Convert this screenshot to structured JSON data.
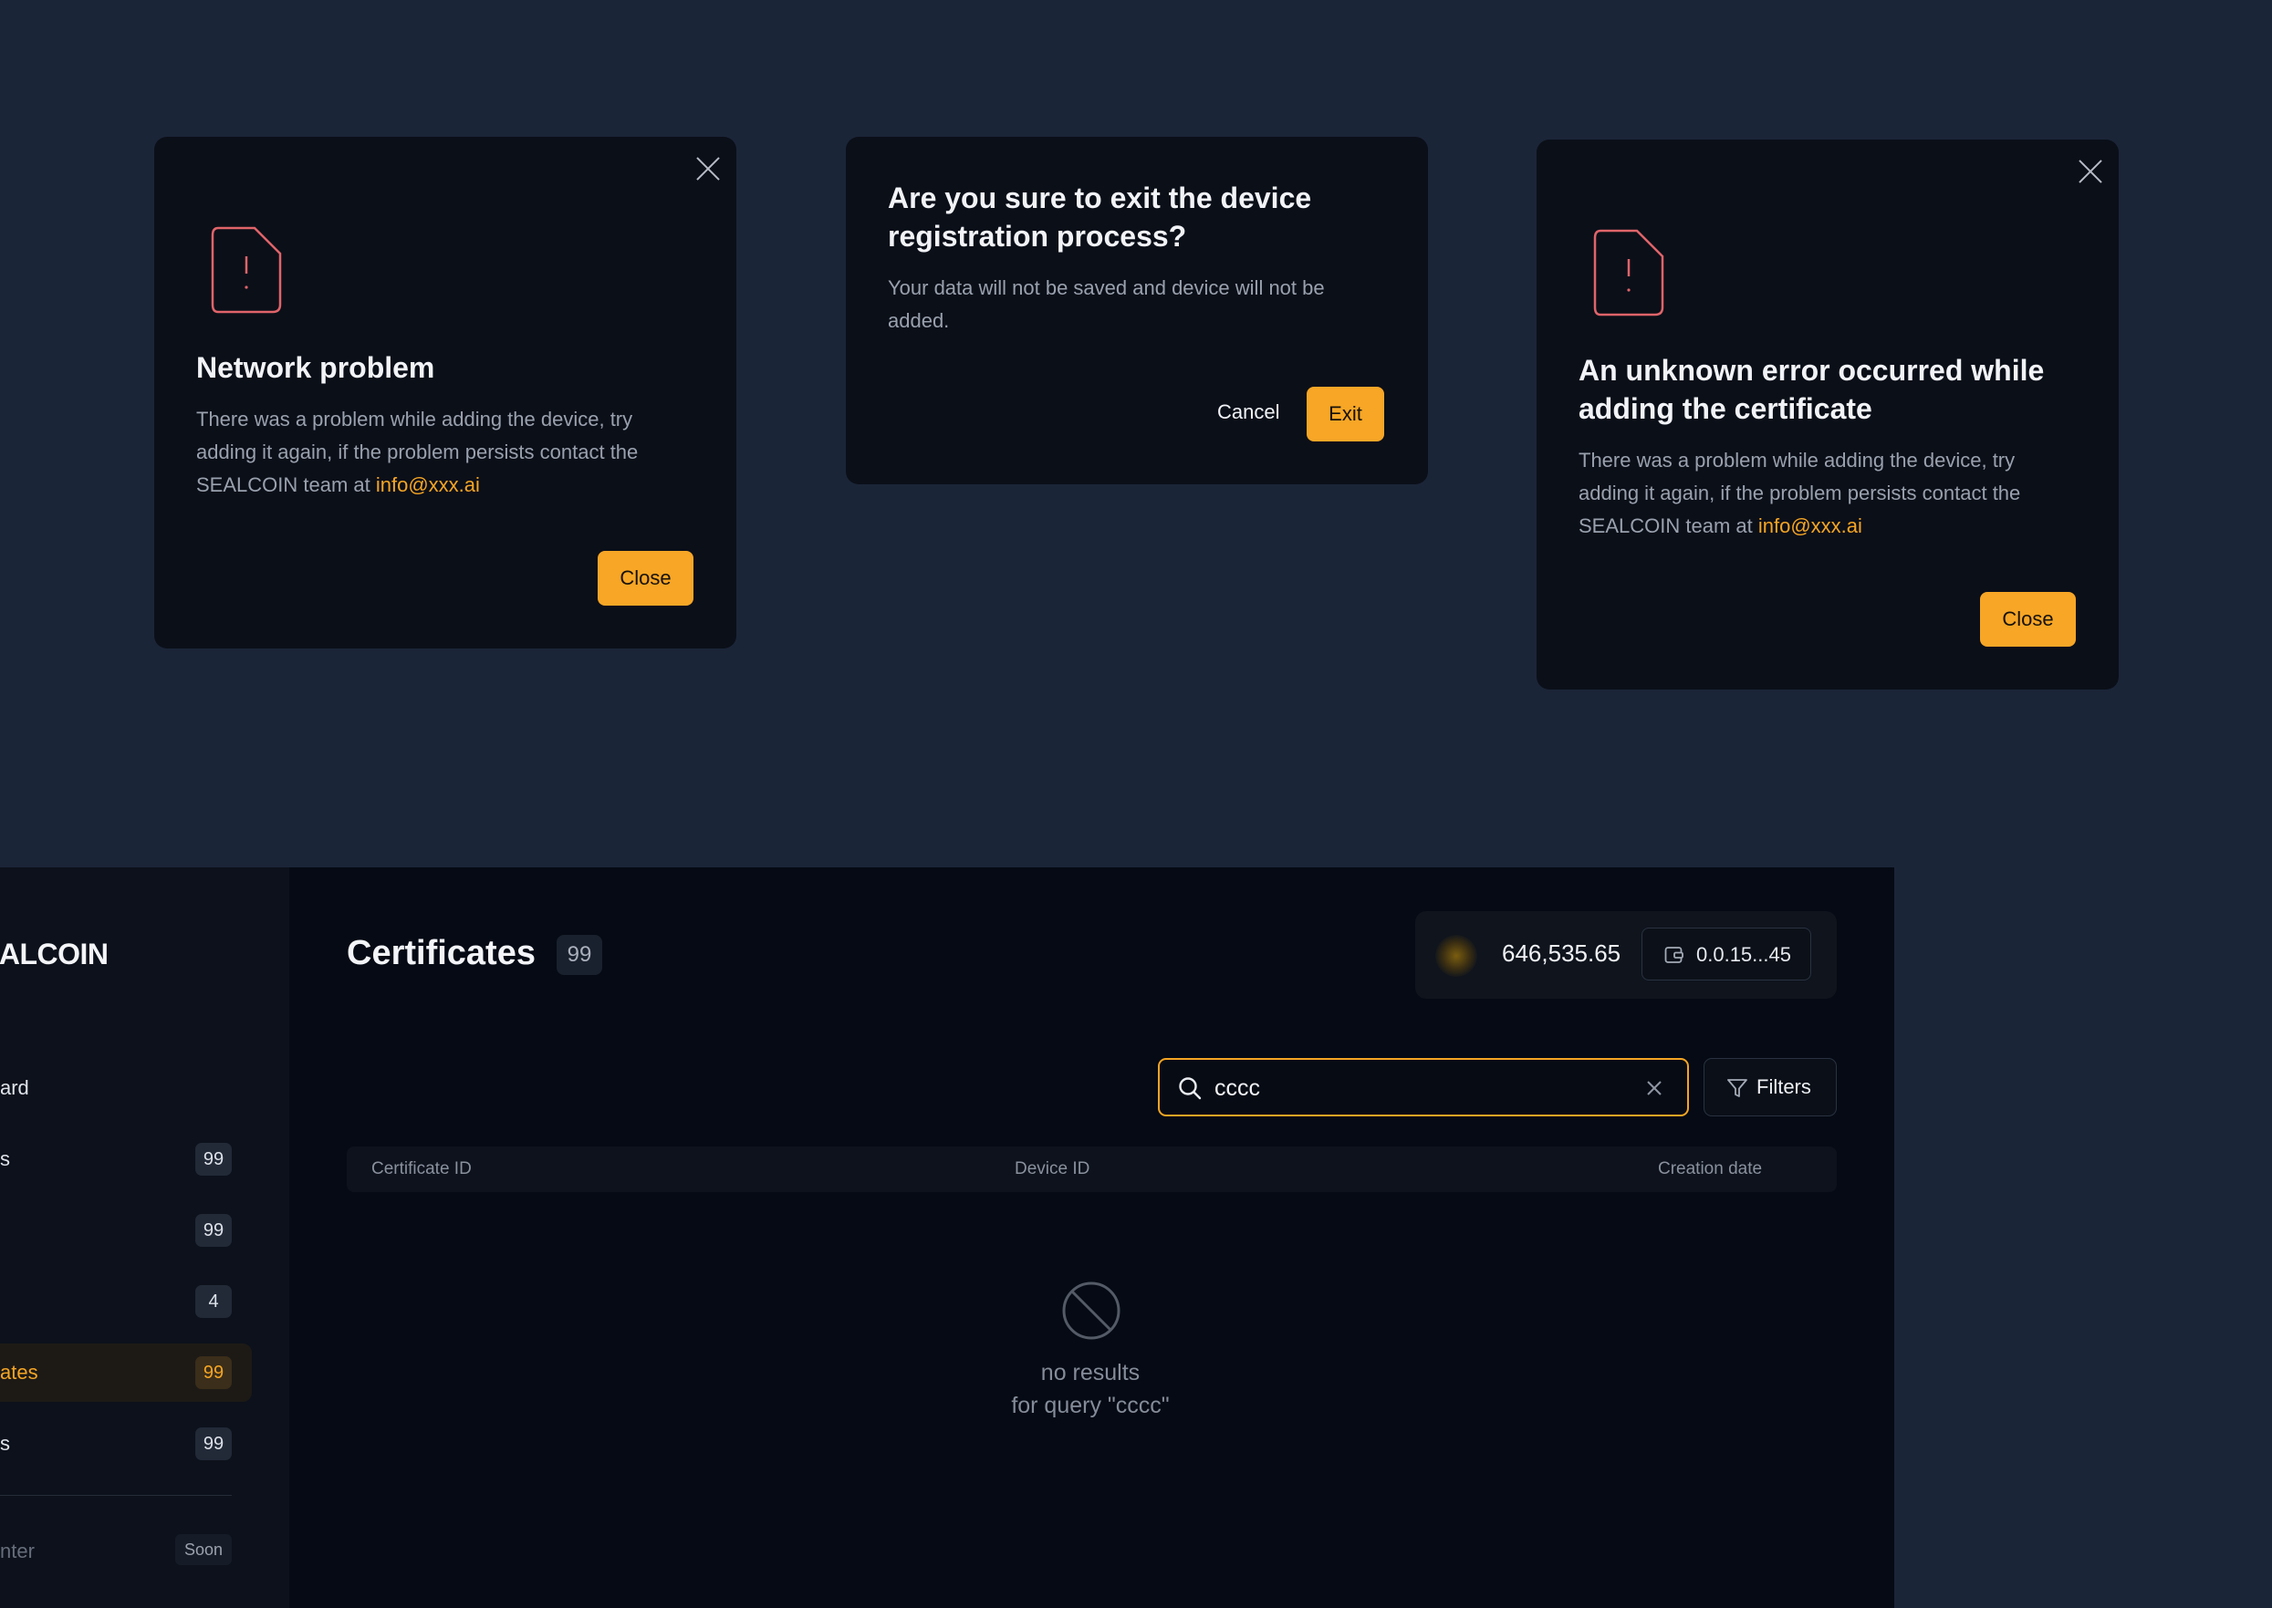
{
  "modal_network": {
    "title": "Network problem",
    "body": "There was a problem while adding the device, try adding it again, if the problem persists contact the SEALCOIN team at ",
    "email": "info@xxx.ai",
    "close_label": "Close"
  },
  "modal_exit": {
    "title": "Are you sure to exit the device registration process?",
    "body": "Your data will not be saved and device will not be added.",
    "cancel_label": "Cancel",
    "exit_label": "Exit"
  },
  "modal_unknown": {
    "title": "An unknown error occurred while adding the certificate",
    "body": "There was a problem while adding the device, try adding it again, if the problem persists contact the SEALCOIN team at ",
    "email": "info@xxx.ai",
    "close_label": "Close"
  },
  "sidebar": {
    "logo": "EALCOIN",
    "items": [
      {
        "label": "ard",
        "badge": ""
      },
      {
        "label": "s",
        "badge": "99"
      },
      {
        "label": "",
        "badge": "99"
      },
      {
        "label": "",
        "badge": "4"
      },
      {
        "label": "ates",
        "badge": "99"
      },
      {
        "label": "s",
        "badge": "99"
      }
    ],
    "soon_item": {
      "label": "nter",
      "badge": "Soon"
    }
  },
  "header": {
    "title": "Certificates",
    "count": "99",
    "balance": "646,535.65",
    "address": "0.0.15...45"
  },
  "search": {
    "value": "cccc"
  },
  "filters_label": "Filters",
  "table": {
    "columns": [
      "Certificate ID",
      "Device ID",
      "Creation date"
    ]
  },
  "empty": {
    "line1": "no results",
    "line2": "for query \"cccc\""
  },
  "colors": {
    "accent": "#f7a626",
    "error": "#e0646a",
    "background": "#1b2538"
  }
}
